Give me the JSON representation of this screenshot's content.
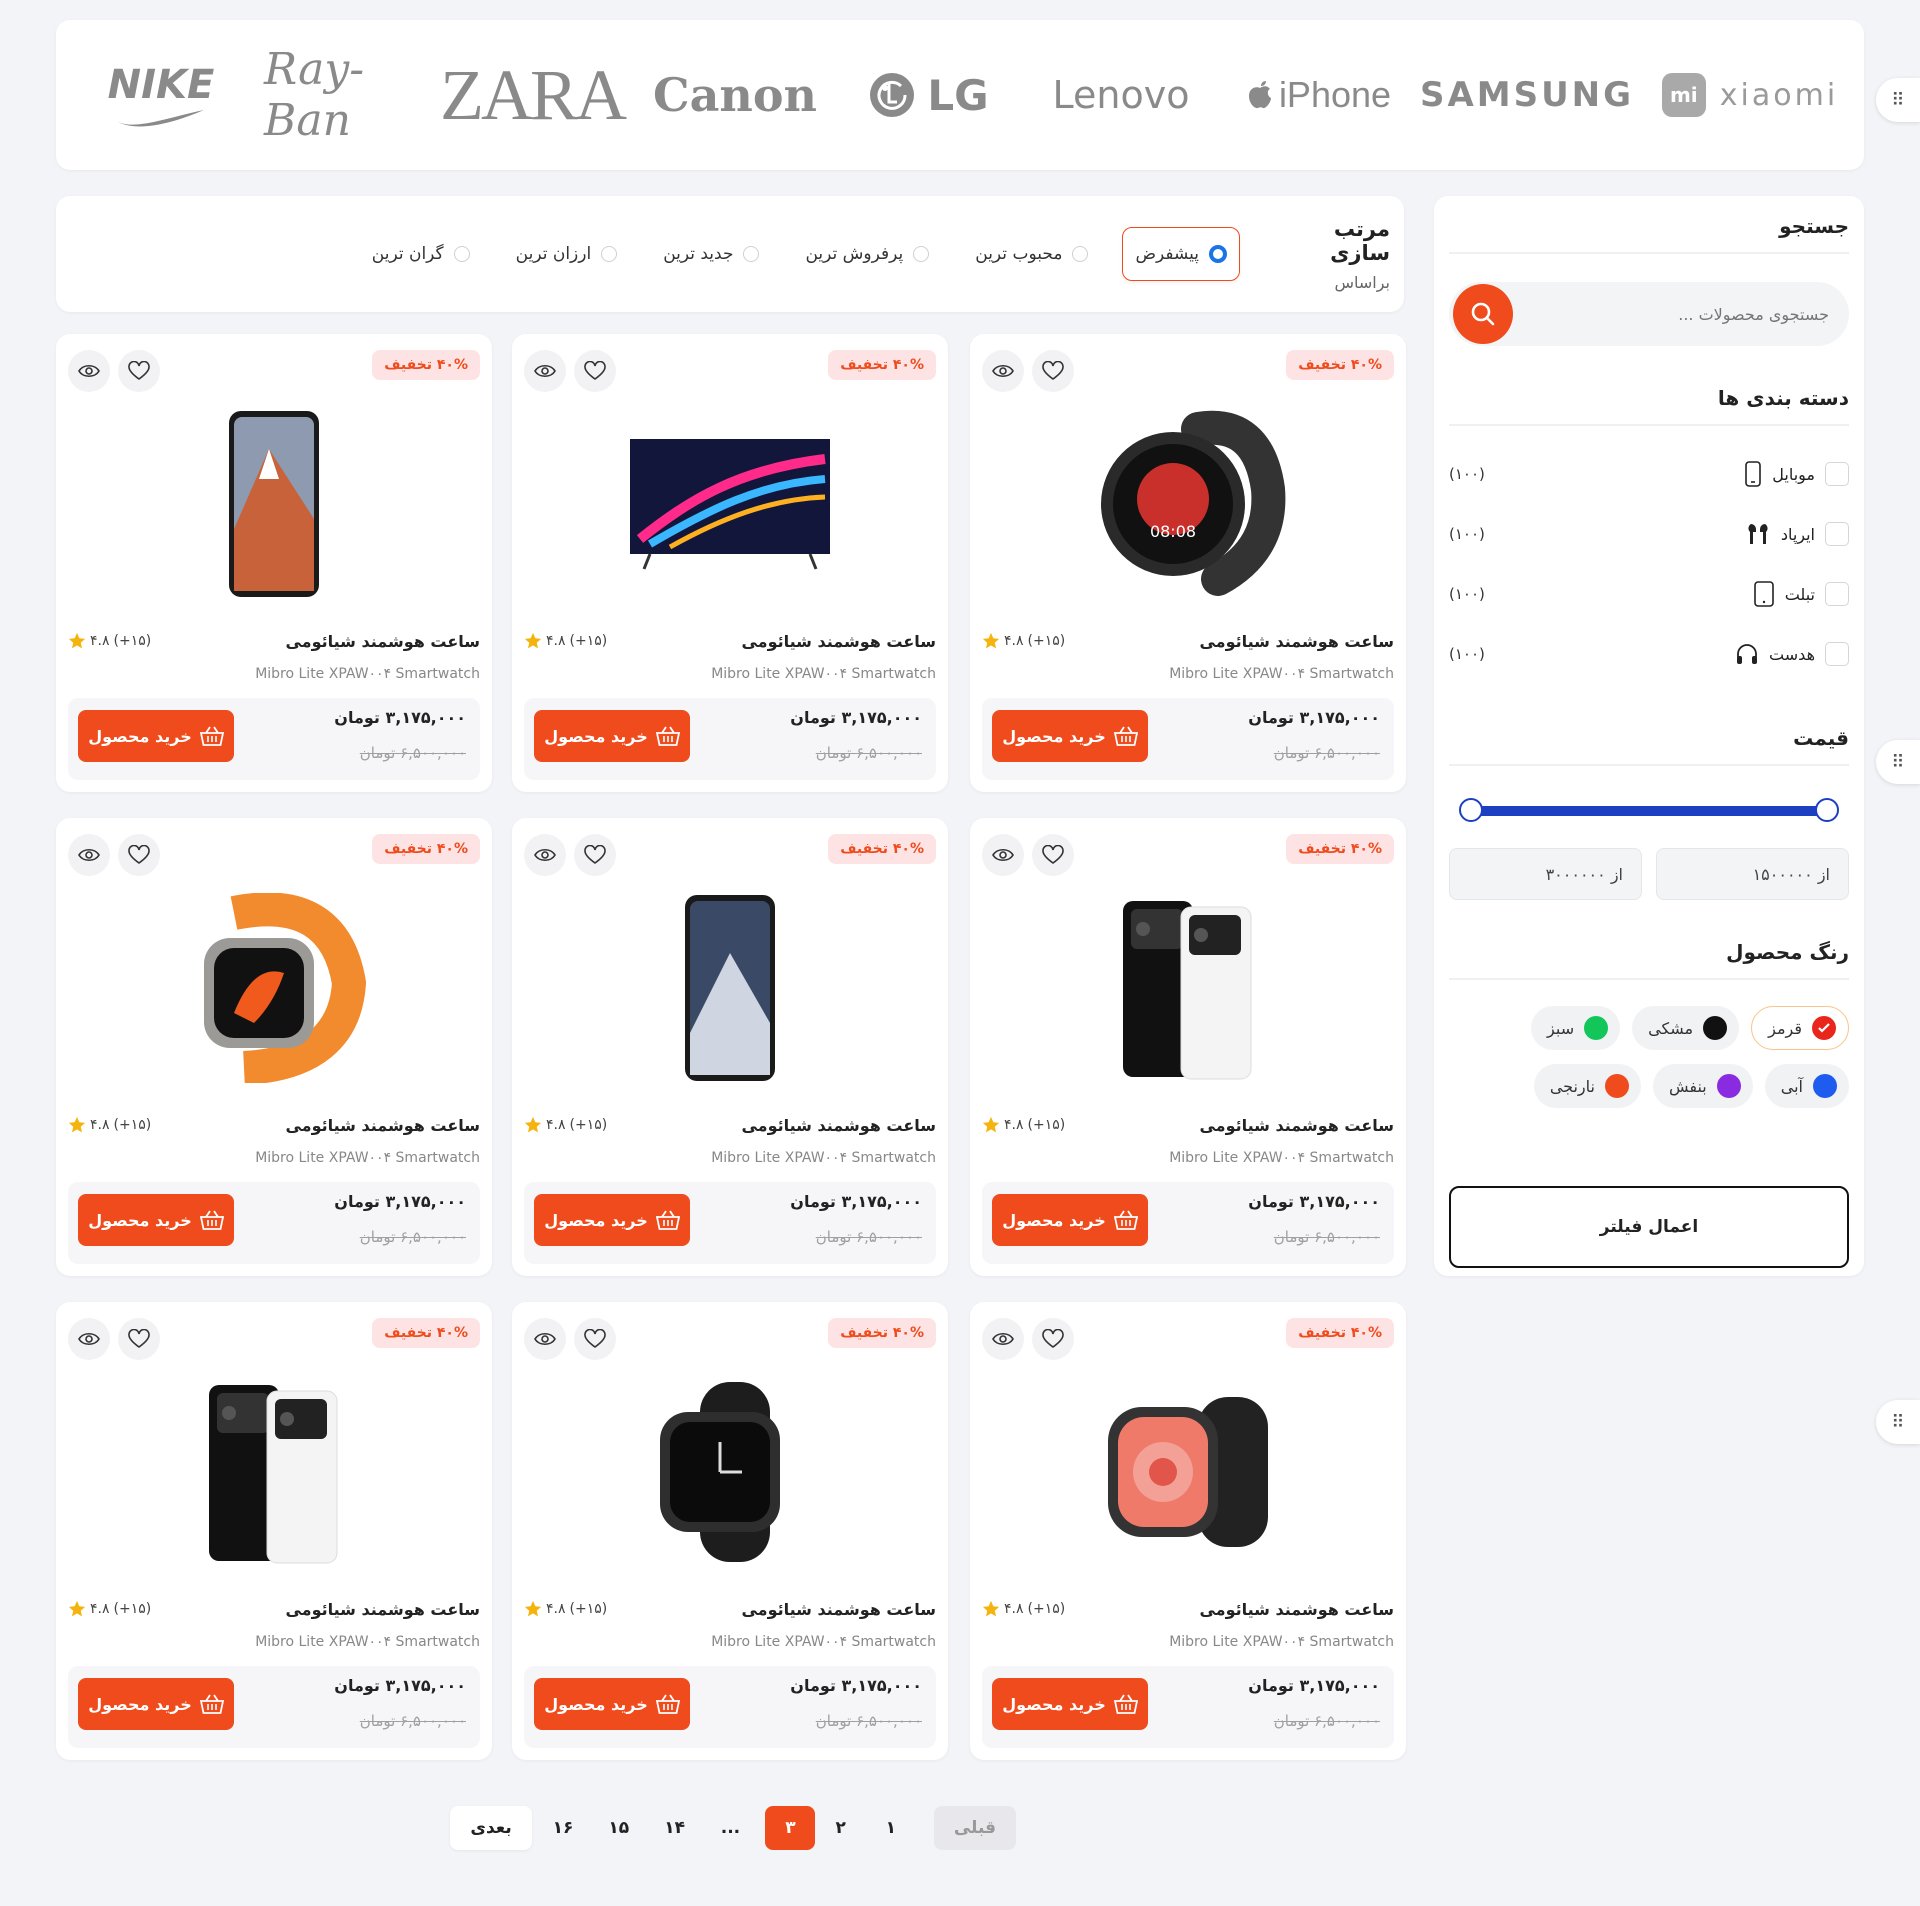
{
  "brands": [
    "NIKE",
    "Ray-Ban",
    "ZARA",
    "Canon",
    "LG",
    "Lenovo",
    "iPhone",
    "SAMSUNG",
    "xiaomi"
  ],
  "brand_extra": {
    "xiaomi_mark": "mi"
  },
  "sidebar": {
    "search_title": "جستجو",
    "search_placeholder": "جستجوی محصولات ...",
    "categories_title": "دسته بندی ها",
    "categories": [
      {
        "label": "موبایل",
        "icon": "mobile-icon",
        "count": "(۱۰۰)"
      },
      {
        "label": "ایرپاد",
        "icon": "airpods-icon",
        "count": "(۱۰۰)"
      },
      {
        "label": "تبلت",
        "icon": "tablet-icon",
        "count": "(۱۰۰)"
      },
      {
        "label": "هدست",
        "icon": "headset-icon",
        "count": "(۱۰۰)"
      }
    ],
    "price_title": "قیمت",
    "price_from_label": "از ۱۵۰۰۰۰۰",
    "price_to_label": "از ۳۰۰۰۰۰۰",
    "price_range_fraction": [
      0,
      1
    ],
    "color_title": "رنگ محصول",
    "colors": [
      {
        "label": "قرمز",
        "hex": "#e8261c",
        "selected": true
      },
      {
        "label": "مشکی",
        "hex": "#111111",
        "selected": false
      },
      {
        "label": "سبز",
        "hex": "#12c65a",
        "selected": false
      },
      {
        "label": "آبی",
        "hex": "#1e5cf0",
        "selected": false
      },
      {
        "label": "بنفش",
        "hex": "#8a2be2",
        "selected": false
      },
      {
        "label": "نارنجی",
        "hex": "#f04b1c",
        "selected": false
      }
    ],
    "apply_label": "اعمال فیلتر"
  },
  "sort": {
    "title": "مرتب سازی",
    "subtitle": "براساس",
    "options": [
      "پیشفرض",
      "محبوب ترین",
      "پرفروش ترین",
      "جدید ترین",
      "ارزان ترین",
      "گران ترین"
    ],
    "active": 0
  },
  "product_template": {
    "badge": "۴۰% تخفیف",
    "title": "ساعت هوشمند شیائومی",
    "subtitle": "Mibro Lite XPAW۰۰۴ Smartwatch",
    "rating": "۴.۸",
    "rating_count": "(+۱۵)",
    "price": "۳,۱۷۵,۰۰۰ تومان",
    "old_price": "۶,۵۰۰,۰۰۰ تومان",
    "buy_label": "خرید محصول"
  },
  "products": [
    {
      "image": "round-watch-image"
    },
    {
      "image": "tv-image"
    },
    {
      "image": "phone-image"
    },
    {
      "image": "dual-phones-image"
    },
    {
      "image": "phone-dark-image"
    },
    {
      "image": "ultra-watch-orange-image"
    },
    {
      "image": "round-watch-red-image"
    },
    {
      "image": "square-watch-black-image"
    },
    {
      "image": "dual-phones-image"
    }
  ],
  "pagination": {
    "next": "بعدی",
    "pages": [
      "۱۶",
      "۱۵",
      "۱۴",
      "...",
      "۳",
      "۲",
      "۱"
    ],
    "current": "۳",
    "prev": "قبلی"
  },
  "colors": {
    "accent": "#f04b1c",
    "slider": "#1d3fc2",
    "radio_on": "#1a73e8"
  }
}
